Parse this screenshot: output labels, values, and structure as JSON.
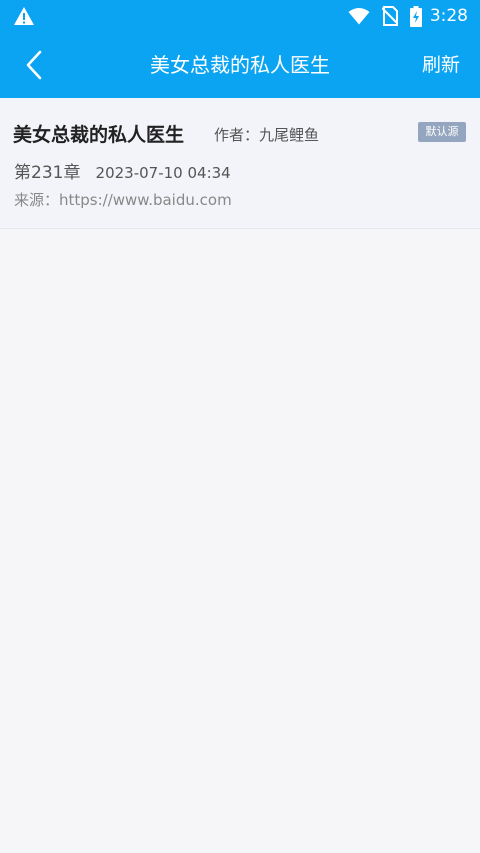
{
  "status_bar": {
    "time": "3:28",
    "icons": [
      "warning-icon",
      "wifi-icon",
      "no-sim-icon",
      "battery-charging-icon"
    ]
  },
  "app_bar": {
    "back_icon": "back-icon",
    "title": "美女总裁的私人医生",
    "refresh_label": "刷新"
  },
  "book": {
    "title": "美女总裁的私人医生",
    "author": "作者：九尾鲤鱼",
    "badge": "默认源",
    "chapter": "第231章",
    "date": "2023-07-10 04:34",
    "source": "来源：https://www.baidu.com"
  },
  "colors": {
    "accent": "#0ba4f2",
    "badge": "#94a6bf",
    "background": "#f6f6f8"
  }
}
